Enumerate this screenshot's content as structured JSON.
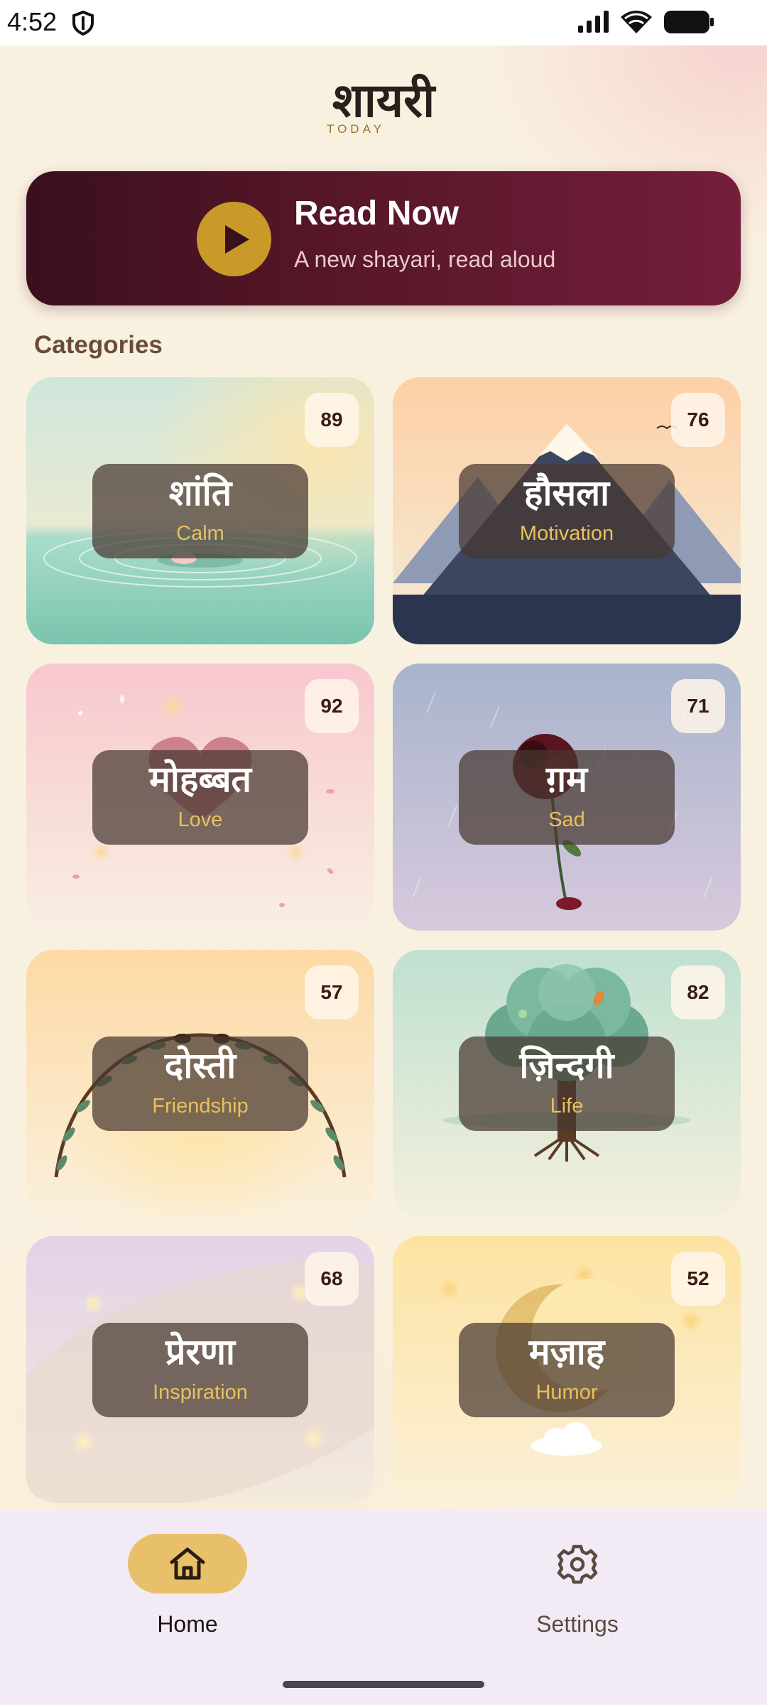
{
  "status_bar": {
    "time": "4:52"
  },
  "header": {
    "title": "शायरी",
    "subtitle": "TODAY"
  },
  "read_now": {
    "title": "Read Now",
    "subtitle": "A new shayari, read aloud"
  },
  "categories_title": "Categories",
  "categories": [
    {
      "hindi": "शांति",
      "english": "Calm",
      "count": "89"
    },
    {
      "hindi": "हौसला",
      "english": "Motivation",
      "count": "76"
    },
    {
      "hindi": "मोहब्बत",
      "english": "Love",
      "count": "92"
    },
    {
      "hindi": "ग़म",
      "english": "Sad",
      "count": "71"
    },
    {
      "hindi": "दोस्ती",
      "english": "Friendship",
      "count": "57"
    },
    {
      "hindi": "ज़िन्दगी",
      "english": "Life",
      "count": "82"
    },
    {
      "hindi": "प्रेरणा",
      "english": "Inspiration",
      "count": "68"
    },
    {
      "hindi": "मज़ाह",
      "english": "Humor",
      "count": "52"
    }
  ],
  "nav": {
    "home": "Home",
    "settings": "Settings"
  },
  "colors": {
    "banner": "#581728",
    "accent_gold": "#c9992a",
    "nav_pill": "#e8c06a"
  }
}
